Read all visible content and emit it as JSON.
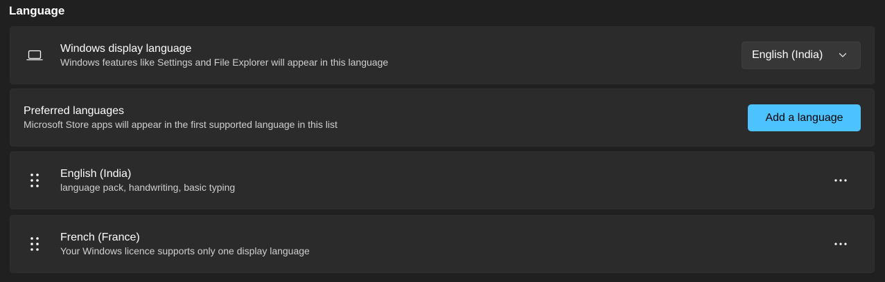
{
  "section_title": "Language",
  "display_language": {
    "title": "Windows display language",
    "description": "Windows features like Settings and File Explorer will appear in this language",
    "icon": "laptop-icon",
    "selected": "English (India)"
  },
  "preferred": {
    "title": "Preferred languages",
    "description": "Microsoft Store apps will appear in the first supported language in this list",
    "button_label": "Add a language"
  },
  "languages": [
    {
      "name": "English (India)",
      "details": "language pack, handwriting, basic typing"
    },
    {
      "name": "French (France)",
      "details": "Your Windows licence supports only one display language"
    }
  ],
  "colors": {
    "accent": "#4cc2ff",
    "background": "#202020",
    "card": "#2b2b2b"
  }
}
